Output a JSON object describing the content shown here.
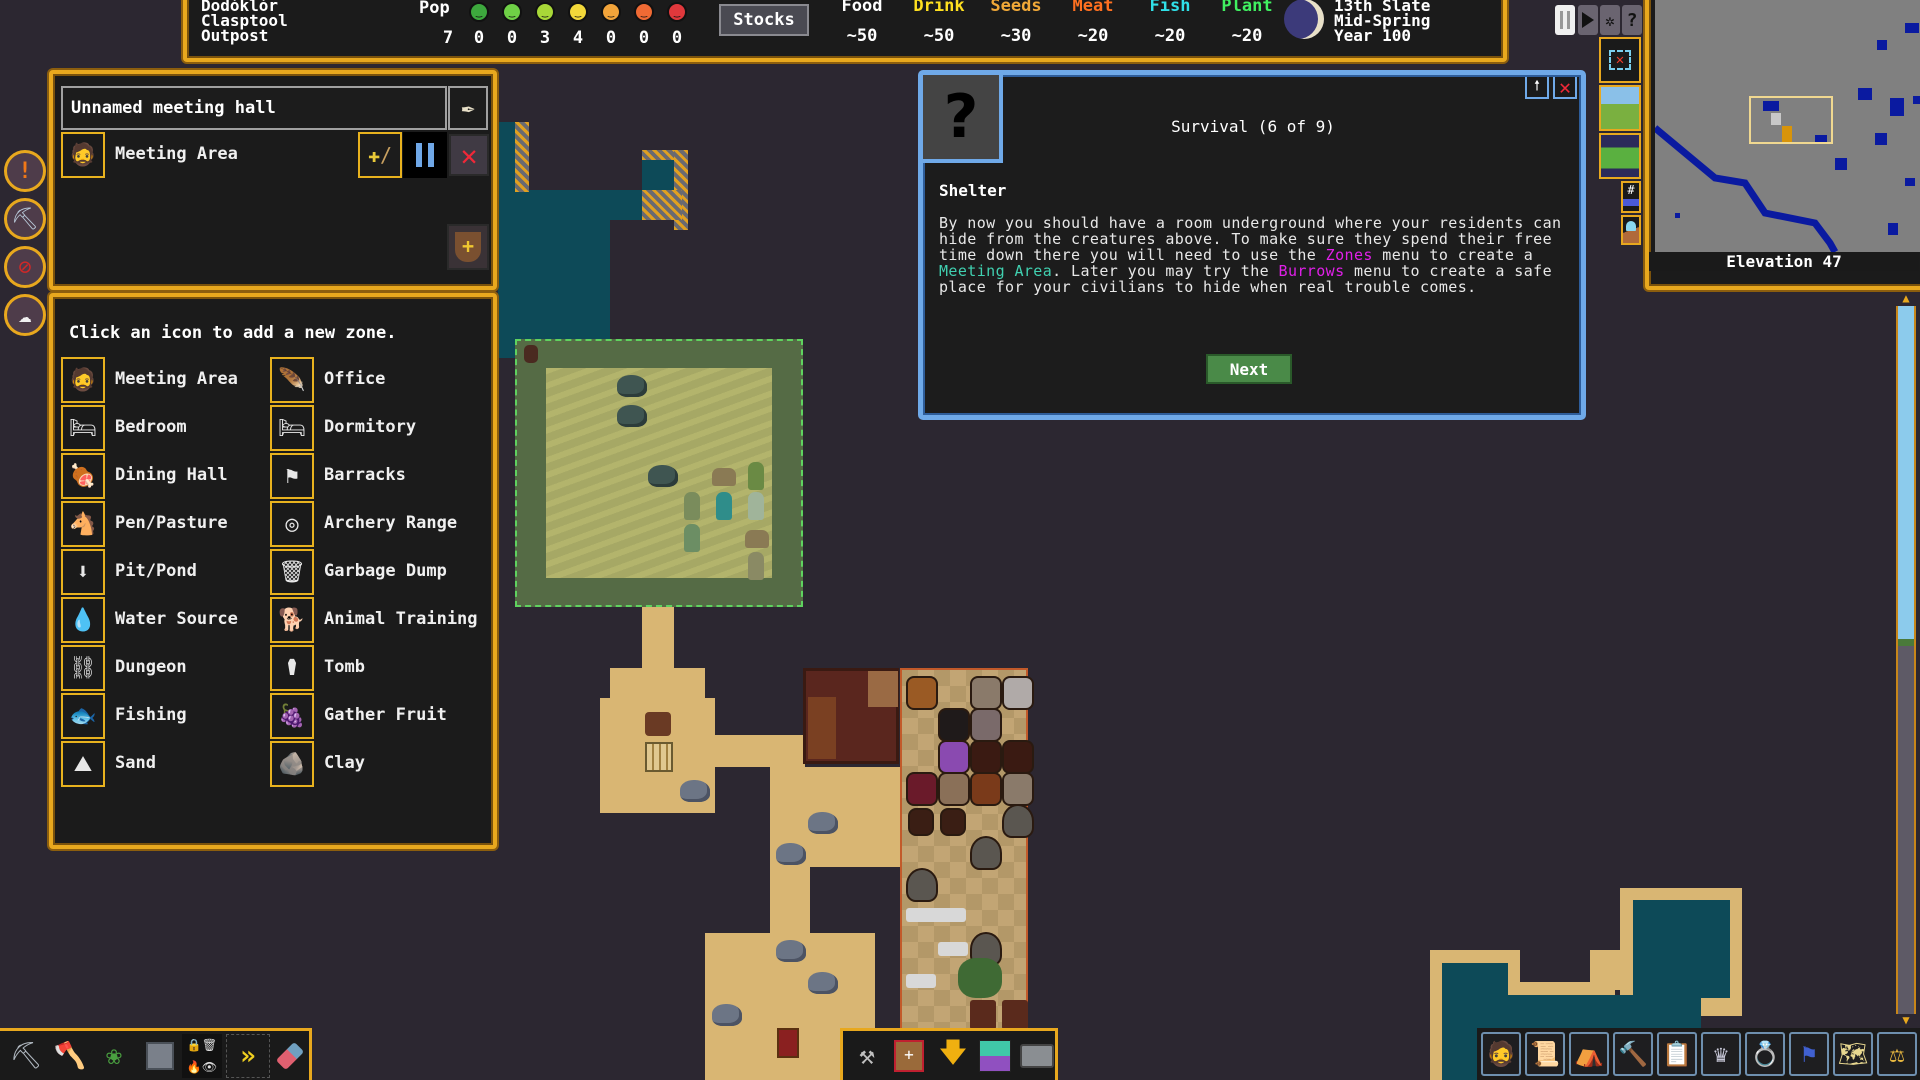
{
  "fortress": {
    "name_line1": "Dodóklòr",
    "name_line2": "Clasptool",
    "name_line3": "Outpost"
  },
  "population": {
    "label": "Pop",
    "total": "7",
    "moods": [
      {
        "name": "ecstatic",
        "color": "#3da83d",
        "count": "0"
      },
      {
        "name": "happy",
        "color": "#6fd046",
        "count": "0"
      },
      {
        "name": "content",
        "color": "#a8d838",
        "count": "3"
      },
      {
        "name": "fine",
        "color": "#f2d83a",
        "count": "4"
      },
      {
        "name": "unhappy",
        "color": "#f2a43a",
        "count": "0"
      },
      {
        "name": "upset",
        "color": "#ef6a34",
        "count": "0"
      },
      {
        "name": "miserable",
        "color": "#e0383c",
        "count": "0"
      }
    ]
  },
  "stocks_button": "Stocks",
  "stocks": [
    {
      "label": "Food",
      "value": "~50",
      "color": "#ffffff"
    },
    {
      "label": "Drink",
      "value": "~50",
      "color": "#ffe020"
    },
    {
      "label": "Seeds",
      "value": "~30",
      "color": "#f0a838"
    },
    {
      "label": "Meat",
      "value": "~20",
      "color": "#ff7020"
    },
    {
      "label": "Fish",
      "value": "~20",
      "color": "#30e0e8"
    },
    {
      "label": "Plant",
      "value": "~20",
      "color": "#40f060"
    }
  ],
  "date": {
    "line1": "13th Slate",
    "line2": "Mid-Spring",
    "line3": "Year 100"
  },
  "game_controls": {
    "pause": "pause-icon",
    "play": "play-icon",
    "settings": "gear-icon",
    "help": "?"
  },
  "minimap": {
    "elevation_label": "Elevation 47"
  },
  "zone_panel": {
    "name_value": "Unnamed meeting hall",
    "zone_type": "Meeting Area"
  },
  "zone_list": {
    "instruction": "Click an icon to add a new zone.",
    "left": [
      {
        "label": "Meeting Area",
        "icon": "🧔"
      },
      {
        "label": "Bedroom",
        "icon": "🛏"
      },
      {
        "label": "Dining Hall",
        "icon": "🍖"
      },
      {
        "label": "Pen/Pasture",
        "icon": "🐴"
      },
      {
        "label": "Pit/Pond",
        "icon": "⬇"
      },
      {
        "label": "Water Source",
        "icon": "💧"
      },
      {
        "label": "Dungeon",
        "icon": "⛓"
      },
      {
        "label": "Fishing",
        "icon": "🐟"
      },
      {
        "label": "Sand",
        "icon": "⛰"
      }
    ],
    "right": [
      {
        "label": "Office",
        "icon": "🪶"
      },
      {
        "label": "Dormitory",
        "icon": "🛏"
      },
      {
        "label": "Barracks",
        "icon": "⚑"
      },
      {
        "label": "Archery Range",
        "icon": "◎"
      },
      {
        "label": "Garbage Dump",
        "icon": "🗑"
      },
      {
        "label": "Animal Training",
        "icon": "🐕"
      },
      {
        "label": "Tomb",
        "icon": "⚰"
      },
      {
        "label": "Gather Fruit",
        "icon": "🍇"
      },
      {
        "label": "Clay",
        "icon": "🪨"
      }
    ]
  },
  "tutorial": {
    "title": "Survival (6 of 9)",
    "heading": "Shelter",
    "body_parts": [
      {
        "text": "By now you should have a room underground where your residents can hide from the creatures above. To make sure they spend their free time down there you will need to use the ",
        "color": "#e8e8e8"
      },
      {
        "text": "Zones",
        "color": "#e020e8"
      },
      {
        "text": " menu to create a ",
        "color": "#e8e8e8"
      },
      {
        "text": "Meeting Area",
        "color": "#40d0b0"
      },
      {
        "text": ". Later you may try the ",
        "color": "#e8e8e8"
      },
      {
        "text": "Burrows",
        "color": "#e020e8"
      },
      {
        "text": " menu to create a safe place for your civilians to hide when real trouble comes.",
        "color": "#e8e8e8"
      }
    ],
    "next_button": "Next"
  },
  "bottom_left_toolbar": [
    "dig",
    "chop-trees",
    "gather-plants",
    "smooth-stone",
    "lock-delete-burn-hide",
    "fast-forward",
    "erase"
  ],
  "bottom_mid_toolbar": [
    "build-construction",
    "place-stockpile",
    "stairs-down",
    "zones-grid",
    "minecart"
  ],
  "bottom_right_toolbar": [
    "citizens",
    "tasks",
    "places",
    "work-orders",
    "labor-checklist",
    "nobles",
    "objects",
    "military",
    "world-map",
    "justice"
  ]
}
